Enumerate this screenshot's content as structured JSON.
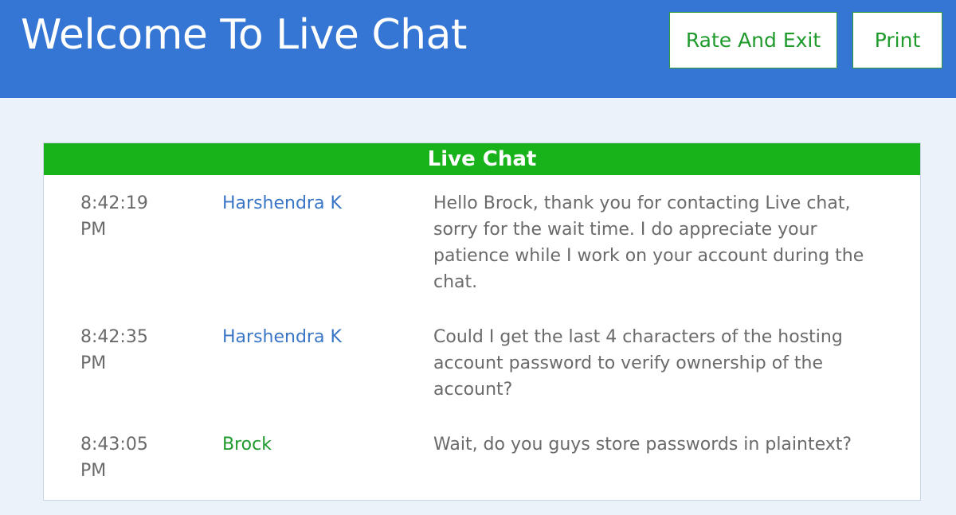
{
  "header": {
    "title": "Welcome To Live Chat",
    "rate_label": "Rate And Exit",
    "print_label": "Print"
  },
  "panel": {
    "title": "Live Chat"
  },
  "messages": [
    {
      "time": "8:42:19 PM",
      "sender": "Harshendra K",
      "text": "Hello Brock, thank you for contacting Live chat, sorry for the wait time. I do appreciate your patience while I work on your account during the chat."
    },
    {
      "time": "8:42:35 PM",
      "sender": "Harshendra K",
      "text": "Could I get the last 4 characters of the hosting account password to verify ownership of the account?"
    },
    {
      "time": "8:43:05 PM",
      "sender": "Brock",
      "text": "Wait, do you guys store passwords in plaintext?"
    }
  ],
  "colors": {
    "header_bg": "#3575d4",
    "panel_head_bg": "#18b31a",
    "agent_name": "#3a76c6",
    "customer_name": "#1f9a2c",
    "page_bg": "#ebf2fa"
  }
}
